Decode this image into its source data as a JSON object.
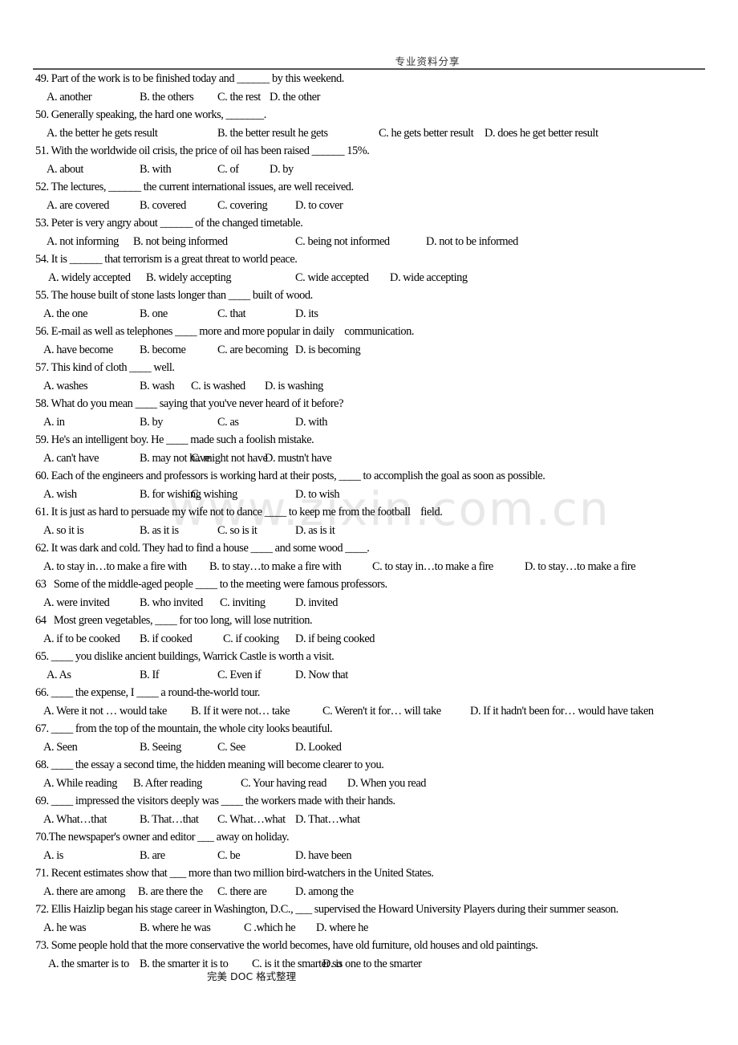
{
  "header": {
    "title": "专业资料分享"
  },
  "footer": {
    "text": "完美 DOC 格式整理"
  },
  "watermark": {
    "text": "www.zixin.com.cn"
  },
  "questions": [
    {
      "stem": "49. Part of the work is to be finished today and ______ by this weekend.",
      "options": [
        "A. another",
        "B. the others",
        "C. the rest",
        "D. the other"
      ]
    },
    {
      "stem": "50. Generally speaking, the hard one works, _______.",
      "options": [
        "A. the better he gets result",
        "B. the better result he gets",
        "C. he gets better result",
        "D. does he get better result"
      ]
    },
    {
      "stem": "51. With the worldwide oil crisis, the price of oil has been raised ______ 15%.",
      "options": [
        "A. about",
        "B. with",
        "C. of",
        "D. by"
      ]
    },
    {
      "stem": "52. The lectures, ______ the current international issues, are well received.",
      "options": [
        "A. are covered",
        "B. covered",
        "C. covering",
        "D. to cover"
      ]
    },
    {
      "stem": "53. Peter is very angry about ______ of the changed timetable.",
      "options": [
        "A. not informing",
        "B. not being informed",
        "C. being not informed",
        "D. not to be informed"
      ]
    },
    {
      "stem": "54. It is ______ that terrorism is a great threat to world peace.",
      "options": [
        "A. widely accepted",
        "B. widely accepting",
        "C. wide accepted",
        "D. wide accepting"
      ]
    },
    {
      "stem": "55. The house built of stone lasts longer than ____ built of wood.",
      "options": [
        "A. the one",
        "B. one",
        "C. that",
        "D. its"
      ]
    },
    {
      "stem": "56. E-mail as well as telephones ____ more and more popular in daily    communication.",
      "options": [
        "A. have become",
        "B. become",
        "C. are becoming",
        "D. is becoming"
      ]
    },
    {
      "stem": "57. This kind of cloth ____ well.",
      "options": [
        "A. washes",
        "B. wash",
        "C. is washed",
        "D. is washing"
      ]
    },
    {
      "stem": "58. What do you mean ____ saying that you've never heard of it before?",
      "options": [
        "A. in",
        "B. by",
        "C. as",
        "D. with"
      ]
    },
    {
      "stem": "59. He's an intelligent boy. He ____ made such a foolish mistake.",
      "options": [
        "A. can't have",
        "B. may not have",
        "C. might not have",
        "D. mustn't have"
      ]
    },
    {
      "stem": "60. Each of the engineers and professors is working hard at their posts, ____ to accomplish the goal as soon as possible.",
      "options": [
        "A. wish",
        "B. for wishing",
        "C. wishing",
        "D. to wish"
      ]
    },
    {
      "stem": "61. It is just as hard to persuade my wife not to dance ____ to keep me from the football    field.",
      "options": [
        "A. so it is",
        "B. as it is",
        "C. so is it",
        "D. as is it"
      ]
    },
    {
      "stem": "62. It was dark and cold. They had to find a house ____ and some wood ____.",
      "options": [
        "A. to stay in…to make a fire with",
        "B. to stay…to make a fire with",
        "C. to stay in…to make a fire",
        "D. to stay…to make a fire"
      ]
    },
    {
      "stem": "63   Some of the middle-aged people ____ to the meeting were famous professors.",
      "options": [
        "A. were invited",
        "B. who invited",
        "C. inviting",
        "D. invited"
      ]
    },
    {
      "stem": "64   Most green vegetables, ____ for too long, will lose nutrition.",
      "options": [
        "A. if to be cooked",
        "B. if cooked",
        "C. if cooking",
        "D. if being cooked"
      ]
    },
    {
      "stem": "65. ____ you dislike ancient buildings, Warrick Castle is worth a visit.",
      "options": [
        "A. As",
        "B. If",
        "C. Even if",
        "D. Now that"
      ]
    },
    {
      "stem": "66. ____ the expense, I ____ a round-the-world tour.",
      "options": [
        "A. Were it not … would take",
        "B. If it were not… take",
        "C. Weren't it for… will take",
        "D. If it hadn't been for… would have taken"
      ]
    },
    {
      "stem": "67. ____ from the top of the mountain, the whole city looks beautiful.",
      "options": [
        "A. Seen",
        "B. Seeing",
        "C. See",
        "D. Looked"
      ]
    },
    {
      "stem": "68. ____ the essay a second time, the hidden meaning will become clearer to you.",
      "options": [
        "A. While reading",
        "B. After reading",
        "C. Your having read",
        "D. When you read"
      ]
    },
    {
      "stem": "69. ____ impressed the visitors deeply was ____ the workers made with their hands.",
      "options": [
        "A. What…that",
        "B. That…that",
        "C. What…what",
        "D. That…what"
      ]
    },
    {
      "stem": "70.The newspaper's owner and editor ___ away on holiday.",
      "options": [
        "A. is",
        "B. are",
        "C. be",
        "D. have been"
      ]
    },
    {
      "stem": "71. Recent estimates show that ___ more than two million bird-watchers in the United States.",
      "options": [
        "A. there are among",
        "B. are there the",
        "C. there are",
        "D. among the"
      ]
    },
    {
      "stem": "72. Ellis Haizlip began his stage career in Washington, D.C., ___ supervised the Howard University Players during their summer season.",
      "options": [
        "A. he was",
        "B. where he was",
        "C .which he",
        "D. where he"
      ]
    },
    {
      "stem": "73. Some people hold that the more conservative the world becomes, have old furniture, old houses and old paintings.",
      "options": [
        "A. the smarter is to",
        "B. the smarter it is to",
        "C. is it the smarter so",
        "D. is one to the smarter"
      ]
    }
  ]
}
